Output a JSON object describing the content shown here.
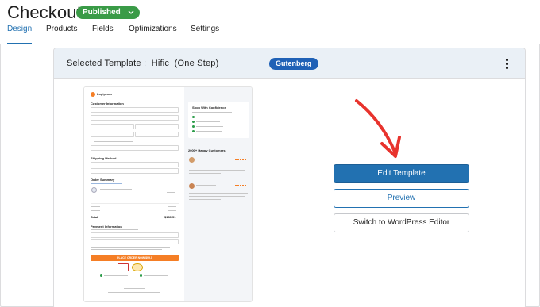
{
  "page": {
    "title": "Checkout",
    "status": "Published"
  },
  "tabs": [
    {
      "label": "Design",
      "active": true
    },
    {
      "label": "Products",
      "active": false
    },
    {
      "label": "Fields",
      "active": false
    },
    {
      "label": "Optimizations",
      "active": false
    },
    {
      "label": "Settings",
      "active": false
    }
  ],
  "template": {
    "prefix": "Selected Template :",
    "name": "Hific",
    "variant": "(One Step)",
    "builder": "Gutenberg"
  },
  "actions": {
    "edit": "Edit Template",
    "preview": "Preview",
    "switch": "Switch to WordPress Editor"
  },
  "preview_page": {
    "logo": "Logipeam",
    "customer_info": "Customer Information",
    "shipping_method": "Shipping Method",
    "order_summary": "Order Summary",
    "total_label": "Total",
    "total_value": "$180.51",
    "payment_info": "Payment Information",
    "place_order": "PLACE ORDER NOW $99.0",
    "shop_confidence": "Shop With Confidence",
    "happy_customers": "2000+ Happy Customers"
  },
  "colors": {
    "brand": "#2271b1",
    "published": "#3a9b47",
    "gutenberg": "#1f61b6",
    "arrow": "#e8332d"
  }
}
